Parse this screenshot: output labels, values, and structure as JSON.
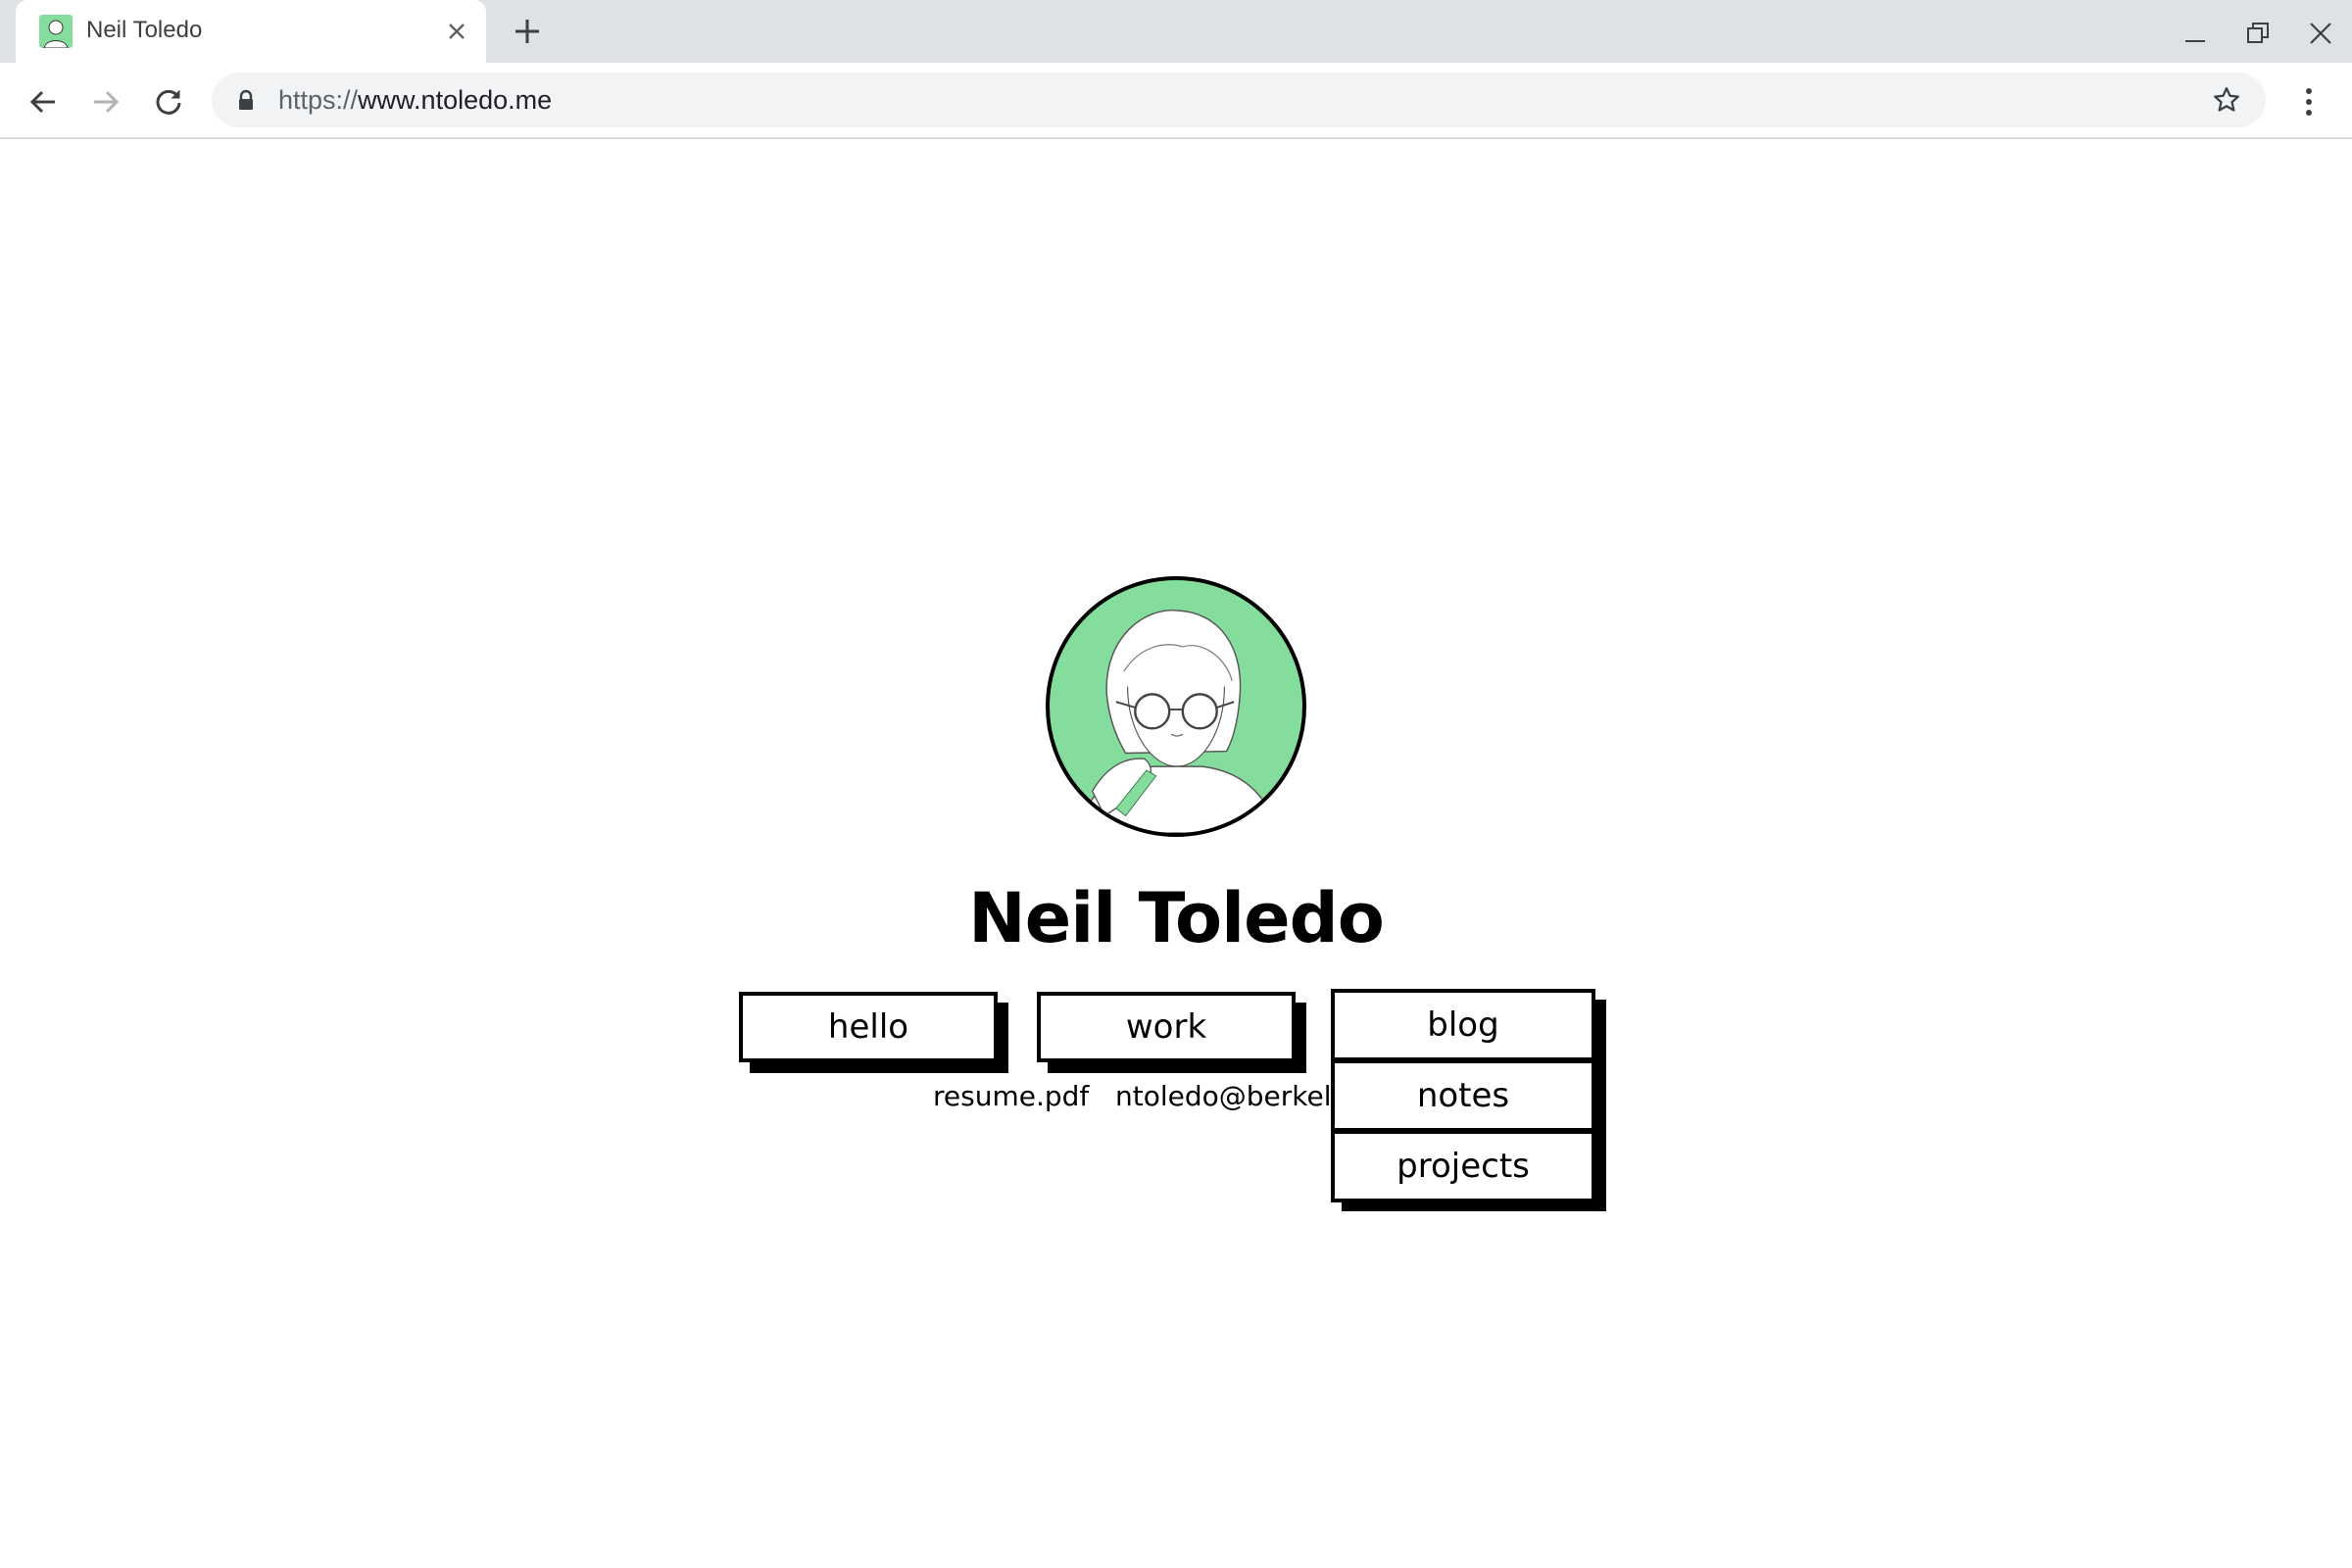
{
  "browser": {
    "tab_title": "Neil Toledo",
    "url_scheme": "https://",
    "url_host": "www.ntoledo.me"
  },
  "page": {
    "name": "Neil Toledo",
    "nav": {
      "hello": "hello",
      "work": "work",
      "blog": "blog",
      "notes": "notes",
      "projects": "projects"
    },
    "links": {
      "resume": "resume.pdf",
      "email": "ntoledo@berkel"
    }
  },
  "colors": {
    "avatar_bg": "#84dd9c",
    "chrome_bg": "#dee1e6",
    "omnibox_bg": "#f1f3f4"
  },
  "icons": [
    "favicon-avatar-icon",
    "close-icon",
    "plus-icon",
    "minimize-icon",
    "restore-icon",
    "window-close-icon",
    "back-arrow-icon",
    "forward-arrow-icon",
    "reload-icon",
    "lock-icon",
    "star-icon",
    "more-vert-icon"
  ]
}
